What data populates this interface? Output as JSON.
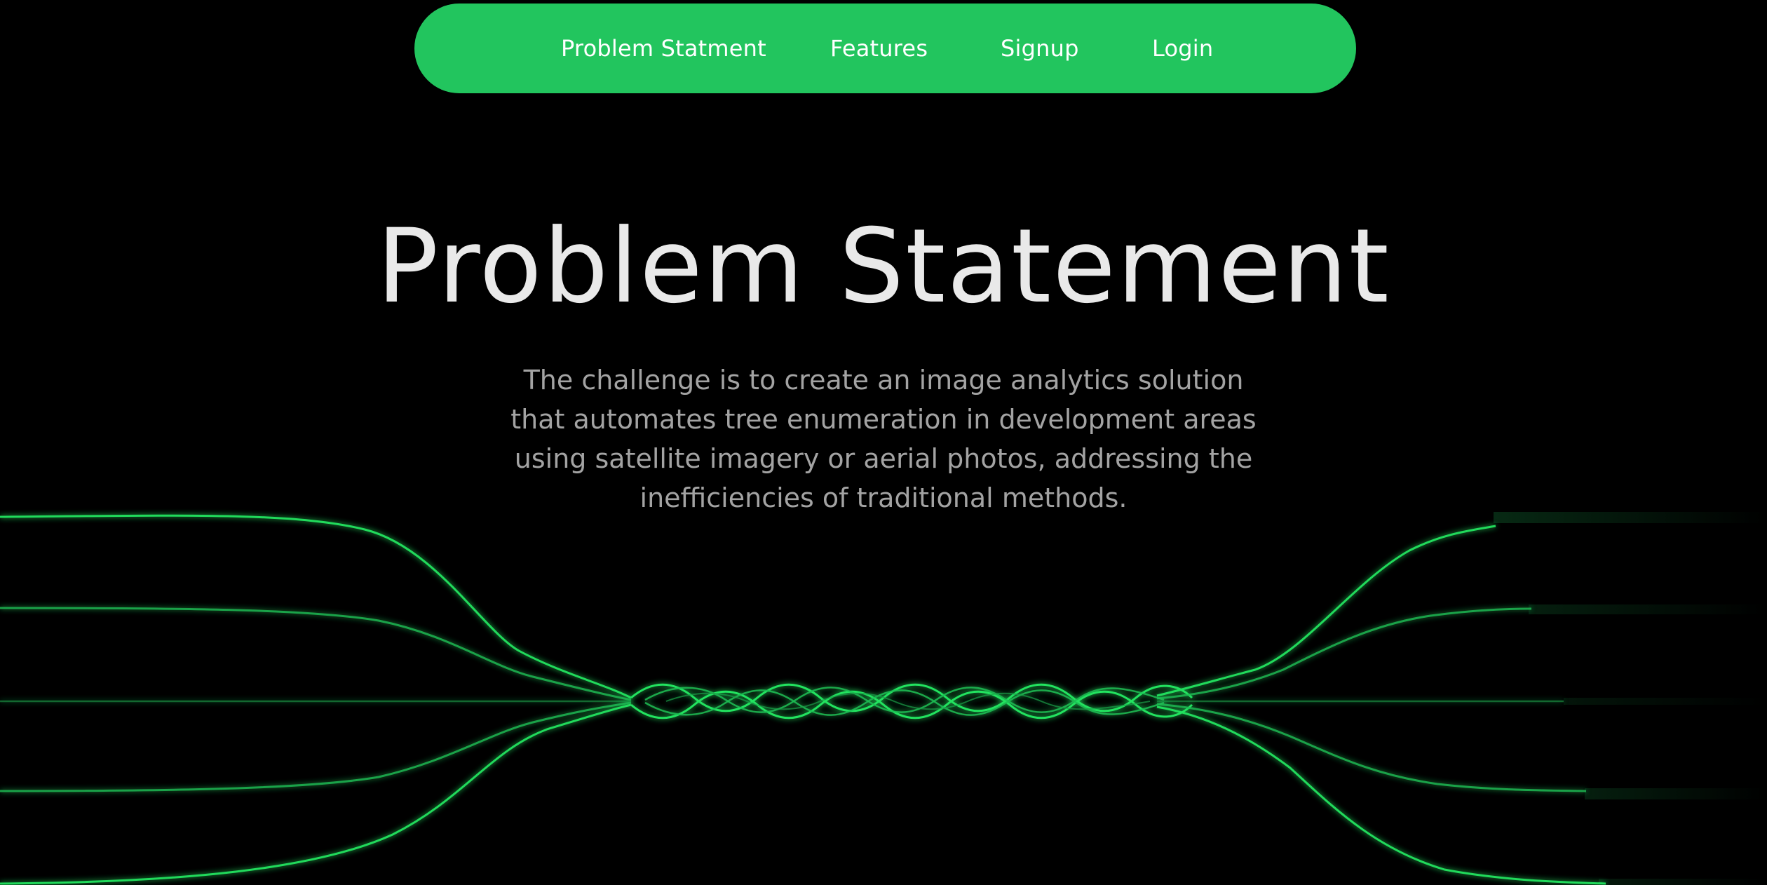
{
  "nav": {
    "items": [
      {
        "label": "Problem Statment"
      },
      {
        "label": "Features"
      },
      {
        "label": "Signup"
      },
      {
        "label": "Login"
      }
    ]
  },
  "hero": {
    "title": "Problem Statement",
    "description": "The challenge is to create an image analytics solution that automates tree enumeration in development areas using satellite imagery or aerial photos, addressing the inefficiencies of traditional methods."
  },
  "colors": {
    "background": "#000000",
    "nav_background": "#22c55e",
    "nav_text": "#ffffff",
    "title_text": "#e9e9e9",
    "body_text": "#a3a3a3",
    "wave_bright": "#22e35f",
    "wave_dim": "#1a9e47"
  }
}
